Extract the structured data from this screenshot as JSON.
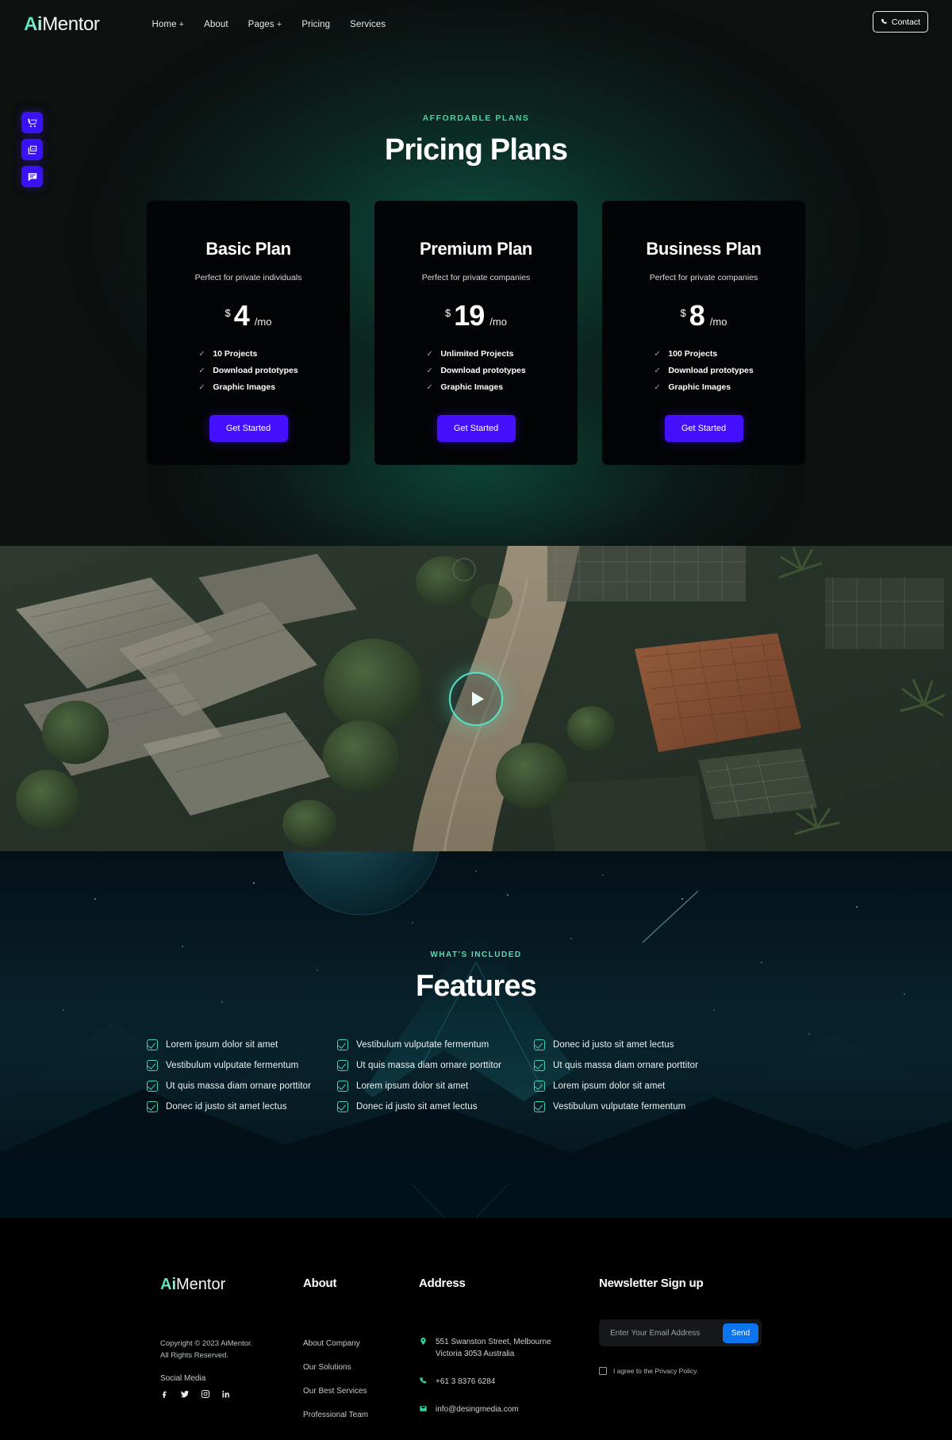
{
  "brand": {
    "prefix": "Ai",
    "suffix": "Mentor"
  },
  "header": {
    "nav": [
      {
        "label": "Home",
        "caret": "+"
      },
      {
        "label": "About",
        "caret": ""
      },
      {
        "label": "Pages",
        "caret": "+"
      },
      {
        "label": "Pricing",
        "caret": ""
      },
      {
        "label": "Services",
        "caret": ""
      }
    ],
    "contact_label": "Contact"
  },
  "dock": [
    {
      "icon": "shopping-cart-icon"
    },
    {
      "icon": "images-icon"
    },
    {
      "icon": "chat-icon"
    }
  ],
  "pricing": {
    "eyebrow": "AFFORDABLE PLANS",
    "title": "Pricing Plans",
    "cta_label": "Get Started",
    "currency": "$",
    "period": "/mo",
    "plans": [
      {
        "title": "Basic Plan",
        "subtitle": "Perfect for private individuals",
        "price": "4",
        "features": [
          "10 Projects",
          "Download prototypes",
          "Graphic Images"
        ]
      },
      {
        "title": "Premium Plan",
        "subtitle": "Perfect for private companies",
        "price": "19",
        "features": [
          "Unlimited Projects",
          "Download prototypes",
          "Graphic Images"
        ]
      },
      {
        "title": "Business Plan",
        "subtitle": "Perfect for private companies",
        "price": "8",
        "features": [
          "100 Projects",
          "Download prototypes",
          "Graphic Images"
        ]
      }
    ]
  },
  "video": {
    "play_icon": "play-icon"
  },
  "features": {
    "eyebrow": "WHAT'S INCLUDED",
    "title": "Features",
    "items": [
      "Lorem ipsum dolor sit amet",
      "Vestibulum vulputate fermentum",
      "Donec id justo sit amet lectus",
      "Vestibulum vulputate fermentum",
      "Ut quis massa diam ornare porttitor",
      "Ut quis massa diam ornare porttitor",
      "Ut quis massa diam ornare porttitor",
      "Lorem ipsum dolor sit amet",
      "Lorem ipsum dolor sit amet",
      "Donec id justo sit amet lectus",
      "Donec id justo sit amet lectus",
      "Vestibulum vulputate fermentum"
    ]
  },
  "footer": {
    "copyright": "Copyright © 2023 AiMentor.\nAll Rights Reserved.",
    "social_label": "Social Media",
    "socials": [
      "facebook-icon",
      "twitter-icon",
      "instagram-icon",
      "linkedin-icon"
    ],
    "about": {
      "heading": "About",
      "links": [
        "About Company",
        "Our Solutions",
        "Our Best Services",
        "Professional Team"
      ]
    },
    "address": {
      "heading": "Address",
      "street": "551 Swanston Street, Melbourne\nVictoria 3053 Australia",
      "phone": "+61 3 8376 6284",
      "email": "info@desingmedia.com"
    },
    "newsletter": {
      "heading": "Newsletter Sign up",
      "placeholder": "Enter Your Email Address",
      "value": "",
      "send_label": "Send",
      "agree_label": "I agree to the Privacy Policy."
    }
  },
  "colors": {
    "accent_teal": "#3ddfa8",
    "cta_blue": "#4410ff",
    "dock_blue": "#3a12f5",
    "send_blue": "#0d74f0",
    "page_bg": "#0c100f",
    "card_bg": "#030405"
  }
}
